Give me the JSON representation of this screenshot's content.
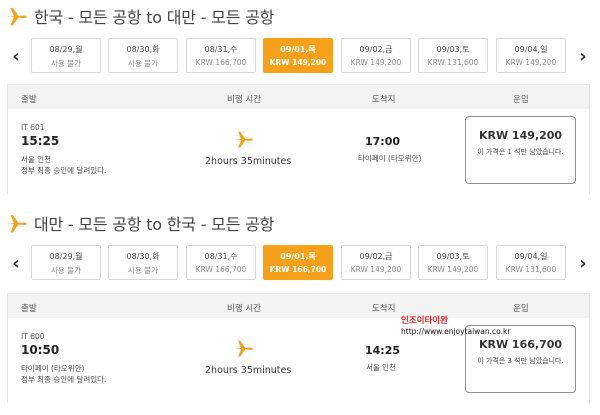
{
  "colors": {
    "accent": "#f7a11a",
    "text": "#333333",
    "panel": "#f3f3f3"
  },
  "sections": [
    {
      "title": "한국 - 모든 공항 to 대만 - 모든 공항",
      "title_icon": "plane-icon",
      "dates": [
        {
          "date": "08/29,월",
          "price": "사용 불가",
          "selected": false
        },
        {
          "date": "08/30,화",
          "price": "사용 불가",
          "selected": false
        },
        {
          "date": "08/31,수",
          "price": "KRW 166,700",
          "selected": false
        },
        {
          "date": "09/01,목",
          "price": "KRW 149,200",
          "selected": true
        },
        {
          "date": "09/02,금",
          "price": "KRW 149,200",
          "selected": false
        },
        {
          "date": "09/03,토",
          "price": "KRW 131,600",
          "selected": false
        },
        {
          "date": "09/04,일",
          "price": "KRW 149,200",
          "selected": false
        }
      ],
      "headers": {
        "departure": "출발",
        "flight_time": "비행 시간",
        "arrival": "도착지",
        "fare": "운임"
      },
      "flight": {
        "flight_no": "IT 601",
        "dep_time": "15:25",
        "dep_city": "서울 인천",
        "note": "정부 최종 승인에 달려있다.",
        "duration": "2hours 35minutes",
        "arr_time": "17:00",
        "arr_city": "타이페이 (타오위안)",
        "price": "KRW 149,200",
        "price_note": "이 가격은 1 석만 남았습니다."
      }
    },
    {
      "title": "대만 - 모든 공항 to 한국 - 모든 공항",
      "title_icon": "plane-icon",
      "dates": [
        {
          "date": "08/29,월",
          "price": "사용 불가",
          "selected": false
        },
        {
          "date": "08/30,화",
          "price": "사용 불가",
          "selected": false
        },
        {
          "date": "08/31,수",
          "price": "KRW 166,700",
          "selected": false
        },
        {
          "date": "09/01,목",
          "price": "KRW 166,700",
          "selected": true
        },
        {
          "date": "09/02,금",
          "price": "KRW 149,200",
          "selected": false
        },
        {
          "date": "09/03,토",
          "price": "KRW 149,200",
          "selected": false
        },
        {
          "date": "09/04,일",
          "price": "KRW 131,600",
          "selected": false
        }
      ],
      "headers": {
        "departure": "출발",
        "flight_time": "비행 시간",
        "arrival": "도착지",
        "fare": "운임"
      },
      "flight": {
        "flight_no": "IT 600",
        "dep_time": "10:50",
        "dep_city": "타이페이 (타오위안)",
        "note": "정부 최종 승인에 달려있다.",
        "duration": "2hours 35minutes",
        "arr_time": "14:25",
        "arr_city": "서울 인천",
        "price": "KRW 166,700",
        "price_note": "이 가격은 3 석만 남았습니다."
      }
    }
  ],
  "watermark": {
    "name": "인조이타이완",
    "url": "http://www.enjoytaiwan.co.kr"
  }
}
